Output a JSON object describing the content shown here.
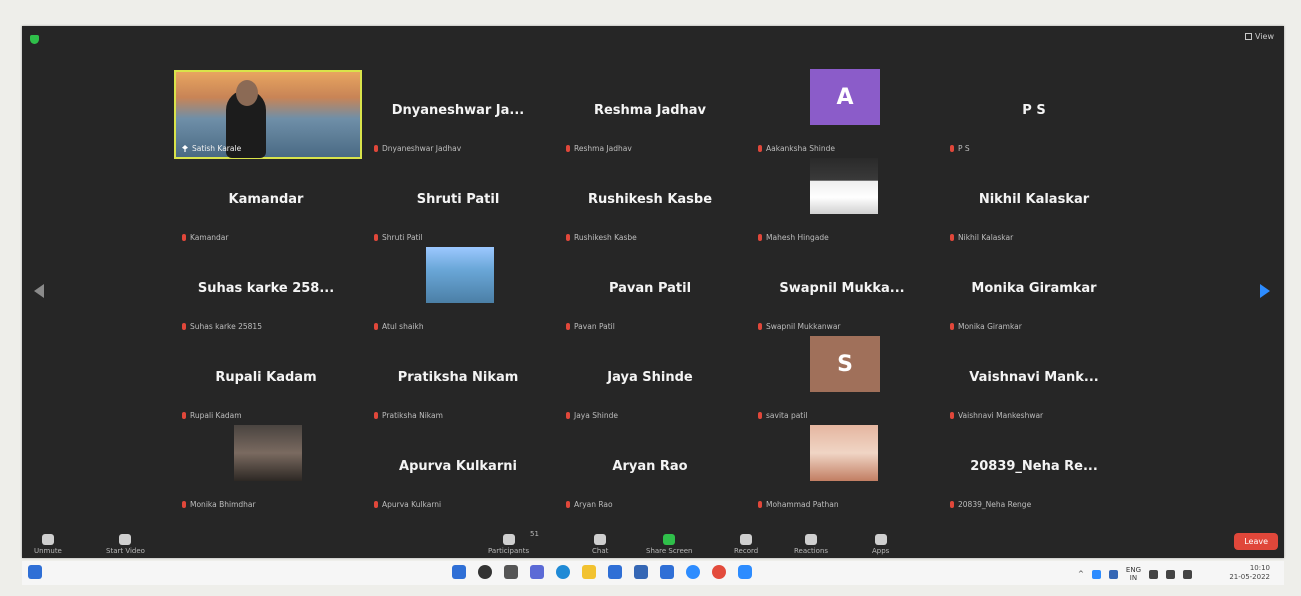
{
  "window": {
    "view_label": "View"
  },
  "participants": [
    {
      "tile_type": "video",
      "name": "",
      "label": "Satish Karale",
      "pinned": true
    },
    {
      "tile_type": "name",
      "name": "Dnyaneshwar Ja...",
      "label": "Dnyaneshwar Jadhav"
    },
    {
      "tile_type": "name",
      "name": "Reshma Jadhav",
      "label": "Reshma Jadhav"
    },
    {
      "tile_type": "avatar",
      "name": "",
      "avatar_letter": "A",
      "avatar_color": "#8b5cc9",
      "label": "Aakanksha Shinde"
    },
    {
      "tile_type": "name",
      "name": "P S",
      "label": "P S"
    },
    {
      "tile_type": "name",
      "name": "Kamandar",
      "label": "Kamandar"
    },
    {
      "tile_type": "name",
      "name": "Shruti Patil",
      "label": "Shruti Patil"
    },
    {
      "tile_type": "name",
      "name": "Rushikesh Kasbe",
      "label": "Rushikesh Kasbe"
    },
    {
      "tile_type": "photo",
      "name": "",
      "label": "Mahesh Hingade"
    },
    {
      "tile_type": "name",
      "name": "Nikhil Kalaskar",
      "label": "Nikhil Kalaskar"
    },
    {
      "tile_type": "name",
      "name": "Suhas karke 258...",
      "label": "Suhas karke 25815"
    },
    {
      "tile_type": "photo",
      "name": "",
      "label": "Atul shaikh"
    },
    {
      "tile_type": "name",
      "name": "Pavan Patil",
      "label": "Pavan Patil"
    },
    {
      "tile_type": "name",
      "name": "Swapnil Mukka...",
      "label": "Swapnil Mukkanwar"
    },
    {
      "tile_type": "name",
      "name": "Monika Giramkar",
      "label": "Monika Giramkar"
    },
    {
      "tile_type": "name",
      "name": "Rupali Kadam",
      "label": "Rupali Kadam"
    },
    {
      "tile_type": "name",
      "name": "Pratiksha Nikam",
      "label": "Pratiksha Nikam"
    },
    {
      "tile_type": "name",
      "name": "Jaya Shinde",
      "label": "Jaya Shinde"
    },
    {
      "tile_type": "avatar",
      "name": "",
      "avatar_letter": "S",
      "avatar_color": "#a0705a",
      "label": "savita patil"
    },
    {
      "tile_type": "name",
      "name": "Vaishnavi Mank...",
      "label": "Vaishnavi Mankeshwar"
    },
    {
      "tile_type": "photo",
      "name": "",
      "label": "Monika Bhimdhar"
    },
    {
      "tile_type": "name",
      "name": "Apurva Kulkarni",
      "label": "Apurva Kulkarni"
    },
    {
      "tile_type": "name",
      "name": "Aryan Rao",
      "label": "Aryan Rao"
    },
    {
      "tile_type": "photo",
      "name": "",
      "label": "Mohammad Pathan"
    },
    {
      "tile_type": "name",
      "name": "20839_Neha Re...",
      "label": "20839_Neha Renge"
    }
  ],
  "toolbar": {
    "unmute": "Unmute",
    "start_video": "Start Video",
    "participants": "Participants",
    "participants_count": "51",
    "chat": "Chat",
    "share_screen": "Share Screen",
    "record": "Record",
    "reactions": "Reactions",
    "apps": "Apps",
    "leave": "Leave"
  },
  "taskbar": {
    "lang": "ENG",
    "lang_sub": "IN",
    "time": "10:10",
    "date": "21-05-2022"
  },
  "colors": {
    "accent_blue": "#2d8cff",
    "leave_red": "#e0473a",
    "active_speaker": "#d9e34a",
    "share_green": "#2fbf4a"
  }
}
